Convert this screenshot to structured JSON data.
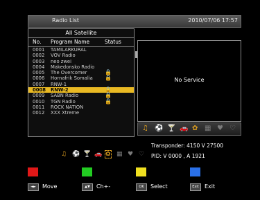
{
  "header": {
    "title": "Radio List",
    "datetime": "2010/07/06 17:57"
  },
  "list": {
    "group": "All Satellite",
    "columns": [
      "No.",
      "Program Name",
      "Status"
    ],
    "rows": [
      {
        "no": "0001",
        "name": "TAMILARKURAL",
        "locked": false
      },
      {
        "no": "0002",
        "name": "VOV Radio",
        "locked": false
      },
      {
        "no": "0003",
        "name": "neo zwei",
        "locked": false
      },
      {
        "no": "0004",
        "name": "Makedonsko Radio",
        "locked": false
      },
      {
        "no": "0005",
        "name": "The Overcomer",
        "locked": true
      },
      {
        "no": "0006",
        "name": "Hornafrik Somalia",
        "locked": true
      },
      {
        "no": "0007",
        "name": "RNW-1",
        "locked": false
      },
      {
        "no": "0008",
        "name": "RNW-2",
        "locked": true,
        "selected": true
      },
      {
        "no": "0009",
        "name": "SABN Radio",
        "locked": true
      },
      {
        "no": "0010",
        "name": "TGN Radio",
        "locked": true
      },
      {
        "no": "0011",
        "name": "ROCK NATION",
        "locked": false
      },
      {
        "no": "0012",
        "name": "XXX Xtreme",
        "locked": false
      }
    ]
  },
  "preview": {
    "status_text": "No Service"
  },
  "category_icons": [
    {
      "icon": "music-note-icon",
      "glyph": "♫",
      "color": "#e0a020"
    },
    {
      "icon": "sports-ball-icon",
      "glyph": "⚽",
      "color": "#e0a020"
    },
    {
      "icon": "martini-glass-icon",
      "glyph": "🍸",
      "color": "#e0a020"
    },
    {
      "icon": "car-icon",
      "glyph": "🚗",
      "color": "#7a7a7a"
    },
    {
      "icon": "flower-icon",
      "glyph": "✿",
      "color": "#e0a020"
    },
    {
      "icon": "grid-icon",
      "glyph": "▦",
      "color": "#7a7a7a"
    },
    {
      "icon": "heart-icon",
      "glyph": "♥",
      "color": "#7a7a7a"
    },
    {
      "icon": "heart-outline-icon",
      "glyph": "♡",
      "color": "#7a7a7a"
    }
  ],
  "info": {
    "transponder": "Transponder: 4150 V 27500",
    "pid": "PID: V 0000 , A 1921"
  },
  "footer": {
    "buttons": [
      {
        "color": "#e01818",
        "key": "◄►",
        "label": "Move"
      },
      {
        "color": "#22cc22",
        "key": "▲▼",
        "label": "Ch+-"
      },
      {
        "color": "#f0e020",
        "key": "OK",
        "label": "Select"
      },
      {
        "color": "#2a70e8",
        "key": "Exit",
        "label": "Exit"
      }
    ]
  }
}
